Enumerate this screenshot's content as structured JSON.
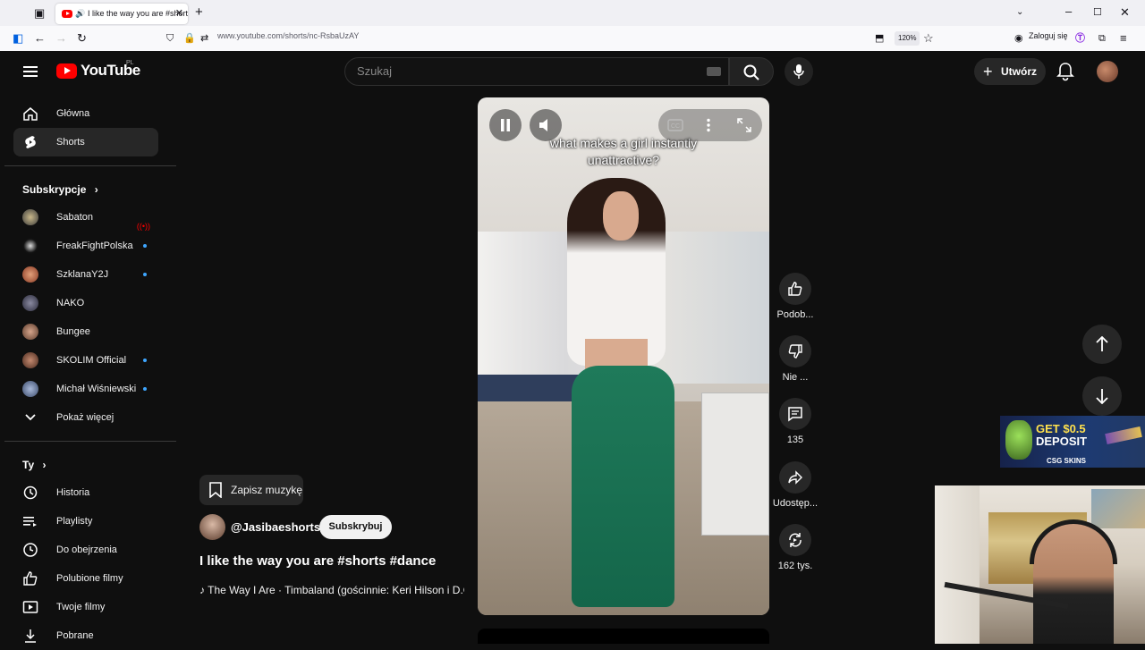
{
  "browser": {
    "tab_title": "I like the way you are #shorts #dance - YouTube",
    "url": "www.youtube.com/shorts/nc-RsbaUzAY",
    "zoom": "120%",
    "login": "Zaloguj się"
  },
  "header": {
    "logo": "YouTube",
    "region": "PL",
    "search_placeholder": "Szukaj",
    "create_label": "Utwórz"
  },
  "sidebar": {
    "nav": [
      {
        "label": "Główna",
        "icon": "home-icon"
      },
      {
        "label": "Shorts",
        "icon": "shorts-icon",
        "active": true
      }
    ],
    "subscriptions_title": "Subskrypcje",
    "subscriptions": [
      {
        "label": "Sabaton",
        "status": "live",
        "avatar_color": "#3a3a3a"
      },
      {
        "label": "FreakFightPolska",
        "status": "new",
        "avatar_color": "#1b1b1b"
      },
      {
        "label": "SzklanaY2J",
        "status": "new",
        "avatar_color": "#b0563d"
      },
      {
        "label": "NAKO",
        "status": "",
        "avatar_color": "#4a4a5a"
      },
      {
        "label": "Bungee",
        "status": "",
        "avatar_color": "#8c6c5c"
      },
      {
        "label": "SKOLIM Official",
        "status": "new",
        "avatar_color": "#7a4a3a"
      },
      {
        "label": "Michał Wiśniewski",
        "status": "new",
        "avatar_color": "#6a7a9a"
      }
    ],
    "show_more": "Pokaż więcej",
    "you_title": "Ty",
    "you_items": [
      {
        "label": "Historia",
        "icon": "history-icon"
      },
      {
        "label": "Playlisty",
        "icon": "playlist-icon"
      },
      {
        "label": "Do obejrzenia",
        "icon": "watch-later-icon"
      },
      {
        "label": "Polubione filmy",
        "icon": "like-icon"
      },
      {
        "label": "Twoje filmy",
        "icon": "your-videos-icon"
      },
      {
        "label": "Pobrane",
        "icon": "download-icon"
      }
    ]
  },
  "short": {
    "caption": "what makes a girl instantly unattractive?",
    "save_music": "Zapisz muzykę",
    "channel": "@Jasibaeshorts",
    "subscribe": "Subskrybuj",
    "title": "I like the way you are #shorts #dance",
    "music": "The Way I Are · Timbaland (gościnnie: Keri Hilson i D.O.E.)"
  },
  "actions": [
    {
      "label": "Podob...",
      "icon": "thumbs-up-icon"
    },
    {
      "label": "Nie ...",
      "icon": "thumbs-down-icon"
    },
    {
      "label": "135",
      "icon": "comment-icon"
    },
    {
      "label": "Udostęp...",
      "icon": "share-icon"
    },
    {
      "label": "162 tys.",
      "icon": "remix-icon"
    }
  ],
  "ad": {
    "line1": "GET $0.5",
    "line2": "DEPOSIT",
    "brand": "CSG SKINS"
  }
}
